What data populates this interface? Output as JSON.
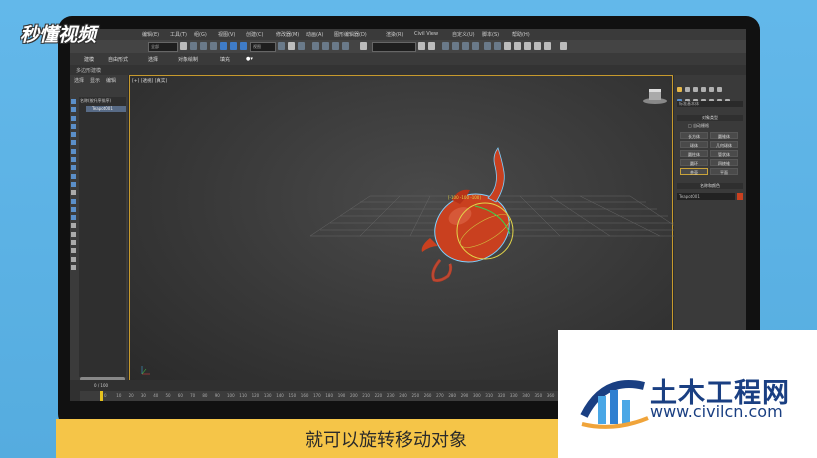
{
  "caption": "就可以旋转移动对象",
  "watermark_topleft": "秒懂视频",
  "civil_logo": {
    "title": "土木工程网",
    "url": "www.civilcn.com"
  },
  "colors": {
    "accent_yellow": "#f5c548",
    "brand_blue": "#1a3f82",
    "teapot_red": "#c9401f",
    "viewport_border": "#c79a2d"
  },
  "app": {
    "menu_items": [
      "编辑(E)",
      "工具(T)",
      "组(G)",
      "视图(V)",
      "创建(C)",
      "修改器(M)",
      "动画(A)",
      "图形编辑器(D)",
      "渲染(R)",
      "Civil View",
      "自定义(U)",
      "脚本(S)",
      "帮助(H)"
    ],
    "toolbar_dropdown_1": "全部",
    "toolbar_dropdown_2": "视图",
    "ribbon_tabs": [
      "建模",
      "自由形式",
      "选择",
      "对象绘制",
      "填充"
    ],
    "ribbon_sub": "多边形建模",
    "scene_explorer": {
      "tabs": [
        "选择",
        "显示",
        "编辑"
      ],
      "header": "名称(按升序排序)",
      "items": [
        "Teapot001"
      ]
    },
    "viewport": {
      "label": "[+] [透视] [真实]",
      "coord_label": "[-100 -100 -100]"
    },
    "command_panel": {
      "category_field": "标准基本体",
      "sections": [
        "对象类型",
        "名称和颜色"
      ],
      "auto_grid": "自动栅格",
      "buttons": [
        "长方体",
        "圆锥体",
        "球体",
        "几何球体",
        "圆柱体",
        "管状体",
        "圆环",
        "四棱锥",
        "茶壶",
        "平面"
      ],
      "object_name": "Teapot001"
    },
    "timeline": {
      "counter": "0 / 100",
      "ticks": [
        "0",
        "10",
        "20",
        "30",
        "40",
        "50",
        "60",
        "70",
        "80",
        "90",
        "100",
        "110",
        "120",
        "130",
        "140",
        "150",
        "160",
        "170",
        "180",
        "190",
        "200",
        "210",
        "220",
        "230",
        "240",
        "250",
        "260",
        "270",
        "280",
        "290",
        "300",
        "310",
        "320",
        "330",
        "340",
        "350",
        "360",
        "370",
        "380",
        "390",
        "400",
        "410",
        "420",
        "430",
        "440",
        "450",
        "460",
        "470"
      ]
    }
  }
}
